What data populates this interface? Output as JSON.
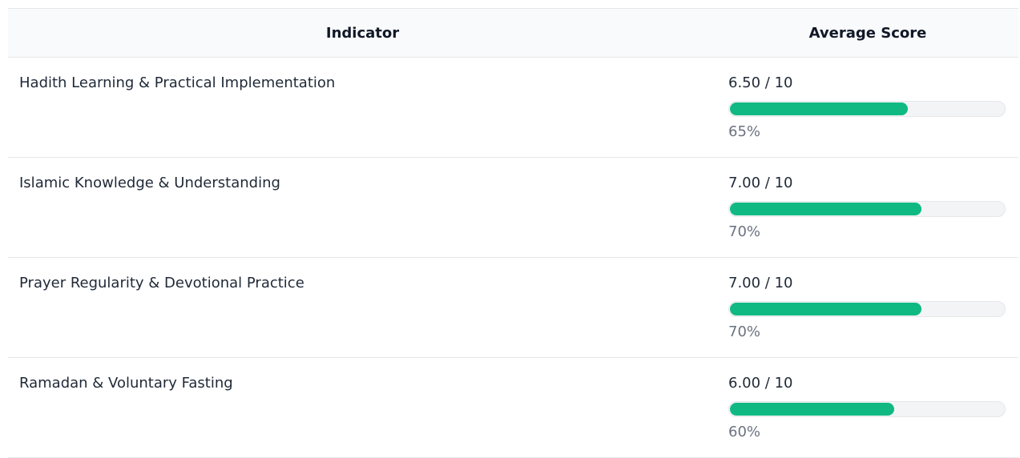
{
  "table": {
    "headers": {
      "indicator": "Indicator",
      "average_score": "Average Score"
    },
    "rows": [
      {
        "indicator": "Hadith Learning & Practical Implementation",
        "score": "6.50 / 10",
        "percent_label": "65%",
        "fraction": 0.65
      },
      {
        "indicator": "Islamic Knowledge & Understanding",
        "score": "7.00 / 10",
        "percent_label": "70%",
        "fraction": 0.7
      },
      {
        "indicator": "Prayer Regularity & Devotional Practice",
        "score": "7.00 / 10",
        "percent_label": "70%",
        "fraction": 0.7
      },
      {
        "indicator": "Ramadan & Voluntary Fasting",
        "score": "6.00 / 10",
        "percent_label": "60%",
        "fraction": 0.6
      }
    ]
  },
  "colors": {
    "bar_fill": "#10b981",
    "bar_track": "#f3f4f6",
    "header_bg": "#f9fafb"
  }
}
